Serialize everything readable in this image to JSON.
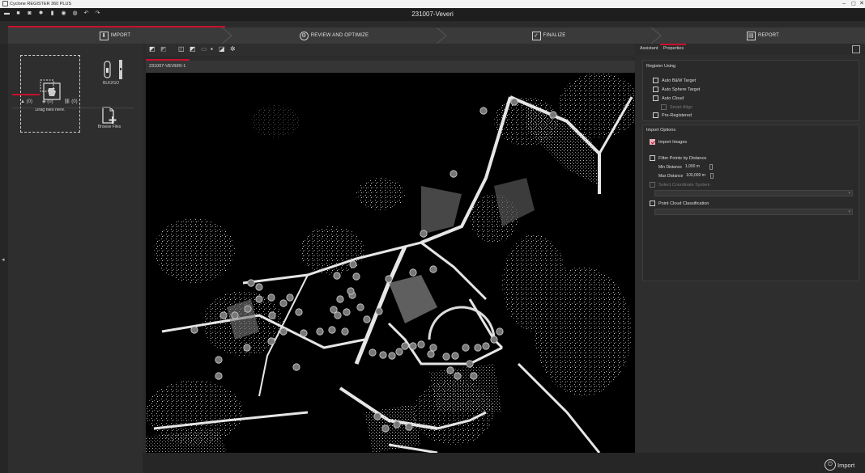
{
  "window": {
    "title": "Cyclone REGISTER 360 PLUS",
    "controls": [
      "–",
      "◻",
      "✕"
    ]
  },
  "toolbar": {
    "document_title": "231007-Veveri",
    "icons": [
      "folder-icon",
      "save-icon",
      "camera-icon",
      "gear-icon",
      "trash-icon",
      "refresh-icon",
      "target-icon",
      "undo-icon",
      "redo-icon"
    ]
  },
  "steps": [
    {
      "label": "IMPORT",
      "icon": "import-icon",
      "active": true
    },
    {
      "label": "REVIEW AND OPTIMIZE",
      "icon": "review-icon",
      "active": false
    },
    {
      "label": "FINALIZE",
      "icon": "finalize-icon",
      "active": false
    },
    {
      "label": "REPORT",
      "icon": "report-icon",
      "active": false
    }
  ],
  "import_panel": {
    "drop_label": "Drag files here.",
    "device_label": "BLK2GO",
    "browse_label": "Browse Files",
    "tabs": [
      {
        "icon": "warning-icon",
        "count": "(0)"
      },
      {
        "icon": "image-icon",
        "count": "(0)"
      },
      {
        "icon": "link-icon",
        "count": "(0)"
      }
    ]
  },
  "viewer": {
    "tab_label": "231007-VEVERI-1"
  },
  "right_panel": {
    "tabs": [
      "Assistant",
      "Properties"
    ],
    "register_using": {
      "title": "Register Using",
      "options": [
        {
          "label": "Auto B&W Target",
          "checked": false,
          "enabled": true
        },
        {
          "label": "Auto Sphere Target",
          "checked": false,
          "enabled": true
        },
        {
          "label": "Auto Cloud",
          "checked": false,
          "enabled": true
        },
        {
          "label": "Smart Align",
          "checked": false,
          "enabled": false
        },
        {
          "label": "Pre-Registered",
          "checked": false,
          "enabled": true
        }
      ]
    },
    "import_options": {
      "title": "Import Options",
      "import_images": {
        "label": "Import Images",
        "checked": true
      },
      "filter_points": {
        "label": "Filter Points by Distance",
        "checked": false
      },
      "min_distance": {
        "label": "Min Distance",
        "value": "1,000 m"
      },
      "max_distance": {
        "label": "Max Distance",
        "value": "100,000 m"
      },
      "coordinate_system": {
        "label": "Select Coordinate System",
        "checked": false,
        "enabled": false
      },
      "classification": {
        "label": "Point Cloud Classification",
        "checked": false,
        "enabled": true
      }
    }
  },
  "footer": {
    "import_button": "Import"
  },
  "colors": {
    "accent": "#c8102e",
    "background": "#2b2b2b",
    "canvas": "#000000"
  }
}
